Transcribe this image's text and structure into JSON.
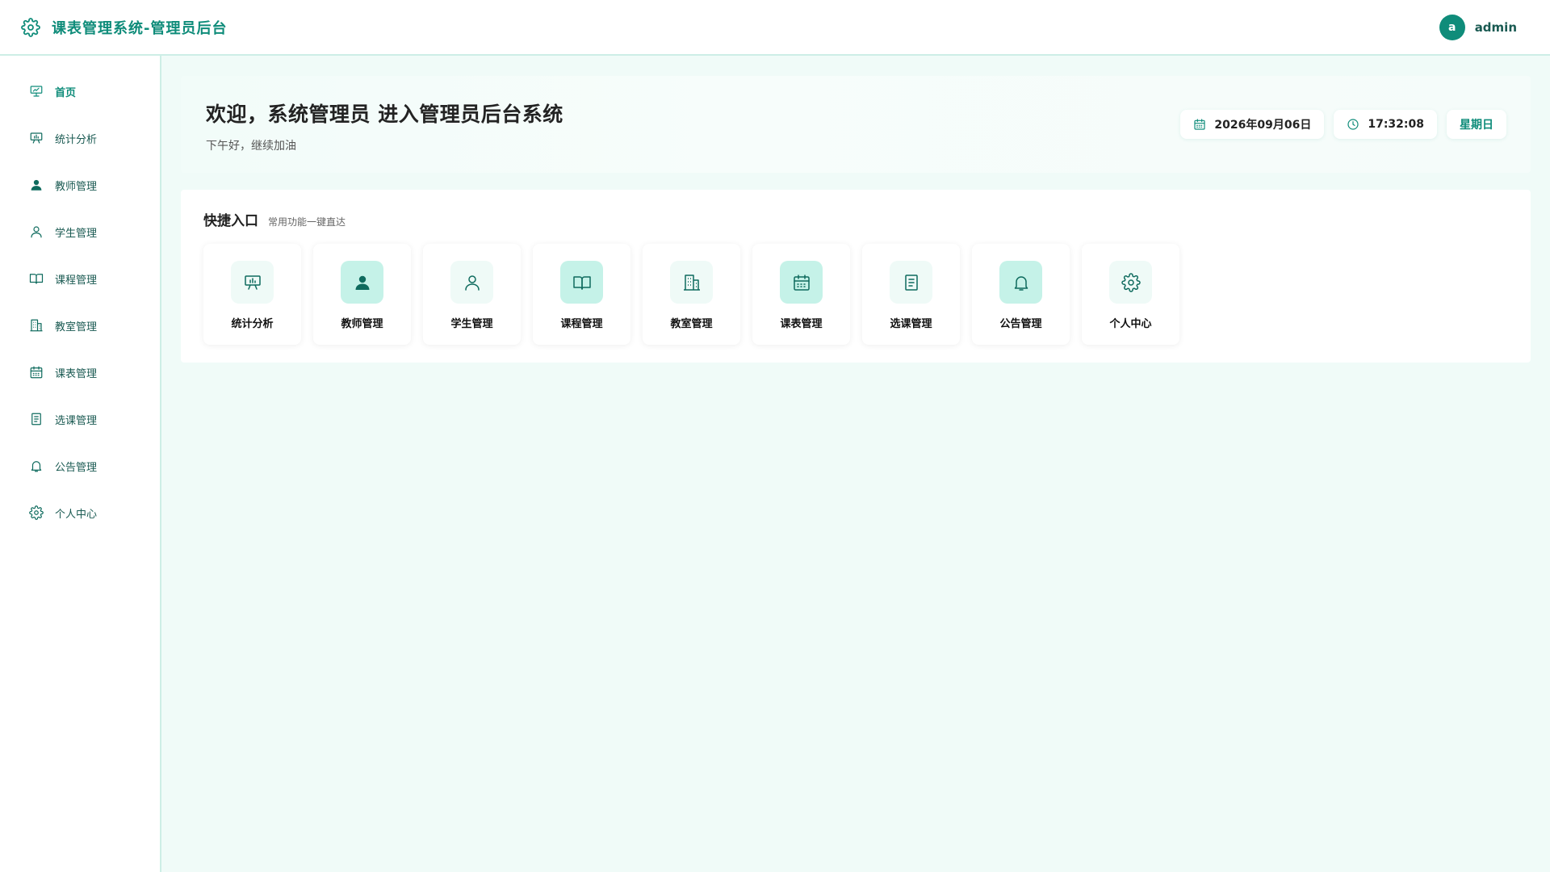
{
  "app": {
    "title": "课表管理系统-管理员后台",
    "accent_color": "#0f8c7a",
    "background_color": "#f0fbf8"
  },
  "user": {
    "avatar_initial": "a",
    "name": "admin"
  },
  "sidebar": {
    "items": [
      {
        "label": "首页",
        "icon": "presentation-icon",
        "active": true
      },
      {
        "label": "统计分析",
        "icon": "presentation-chart-icon"
      },
      {
        "label": "教师管理",
        "icon": "user-filled-icon"
      },
      {
        "label": "学生管理",
        "icon": "user-outline-icon"
      },
      {
        "label": "课程管理",
        "icon": "book-icon"
      },
      {
        "label": "教室管理",
        "icon": "building-icon"
      },
      {
        "label": "课表管理",
        "icon": "calendar-icon"
      },
      {
        "label": "选课管理",
        "icon": "document-icon"
      },
      {
        "label": "公告管理",
        "icon": "bell-icon"
      },
      {
        "label": "个人中心",
        "icon": "gear-icon"
      }
    ]
  },
  "welcome": {
    "title": "欢迎，系统管理员 进入管理员后台系统",
    "subtitle": "下午好，继续加油",
    "date": "2026年09月06日",
    "time": "17:32:08",
    "weekday": "星期日"
  },
  "quick_access": {
    "title": "快捷入口",
    "subtitle": "常用功能一键直达",
    "cards": [
      {
        "label": "统计分析",
        "icon": "presentation-chart-icon"
      },
      {
        "label": "教师管理",
        "icon": "user-filled-icon",
        "highlight": true
      },
      {
        "label": "学生管理",
        "icon": "user-outline-icon"
      },
      {
        "label": "课程管理",
        "icon": "book-icon",
        "highlight": true
      },
      {
        "label": "教室管理",
        "icon": "building-icon"
      },
      {
        "label": "课表管理",
        "icon": "calendar-icon",
        "highlight": true
      },
      {
        "label": "选课管理",
        "icon": "document-icon"
      },
      {
        "label": "公告管理",
        "icon": "bell-icon",
        "highlight": true
      },
      {
        "label": "个人中心",
        "icon": "gear-icon"
      }
    ]
  }
}
